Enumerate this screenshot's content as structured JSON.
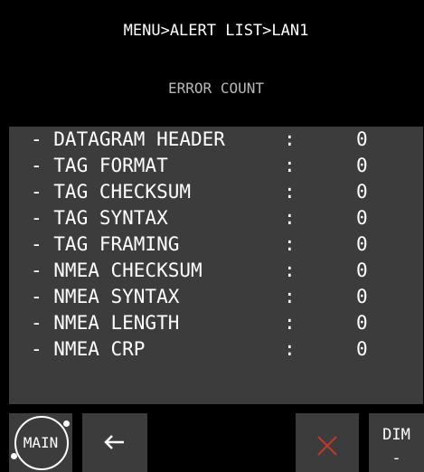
{
  "header": {
    "breadcrumb": "MENU>ALERT LIST>LAN1",
    "subtitle": "ERROR COUNT"
  },
  "rows": [
    {
      "label": "- DATAGRAM HEADER",
      "value": "0"
    },
    {
      "label": "- TAG FORMAT",
      "value": "0"
    },
    {
      "label": "- TAG CHECKSUM",
      "value": "0"
    },
    {
      "label": "- TAG SYNTAX",
      "value": "0"
    },
    {
      "label": "- TAG FRAMING",
      "value": "0"
    },
    {
      "label": "- NMEA CHECKSUM",
      "value": "0"
    },
    {
      "label": "- NMEA SYNTAX",
      "value": "0"
    },
    {
      "label": "- NMEA LENGTH",
      "value": "0"
    },
    {
      "label": "- NMEA CRP",
      "value": "0"
    }
  ],
  "separator": ":",
  "footer": {
    "main_label": "MAIN",
    "dim_label": "DIM",
    "dim_sub": "-"
  },
  "colors": {
    "background": "#000000",
    "panel": "#3c3c3c",
    "text": "#ffffff",
    "cancel": "#c0392b"
  },
  "icons": {
    "back": "left-arrow-icon",
    "cancel": "close-icon"
  }
}
